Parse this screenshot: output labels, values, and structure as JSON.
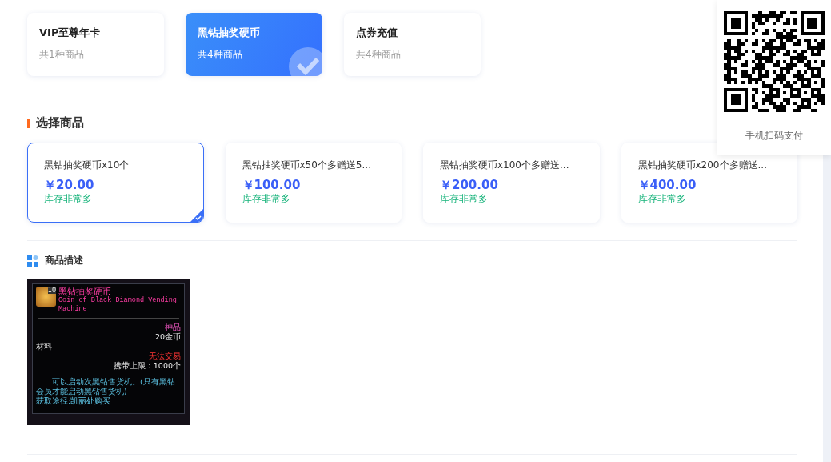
{
  "categories": [
    {
      "name": "VIP至尊年卡",
      "count": "共1种商品",
      "selected": false
    },
    {
      "name": "黑钻抽奖硬币",
      "count": "共4种商品",
      "selected": true
    },
    {
      "name": "点券充值",
      "count": "共4种商品",
      "selected": false
    }
  ],
  "products_section": {
    "title": "选择商品"
  },
  "products": [
    {
      "name": "黑钻抽奖硬币x10个",
      "price": "￥20.00",
      "stock": "库存非常多",
      "selected": true
    },
    {
      "name": "黑钻抽奖硬币x50个多赠送5...",
      "price": "￥100.00",
      "stock": "库存非常多",
      "selected": false
    },
    {
      "name": "黑钻抽奖硬币x100个多赠送...",
      "price": "￥200.00",
      "stock": "库存非常多",
      "selected": false
    },
    {
      "name": "黑钻抽奖硬币x200个多赠送...",
      "price": "￥400.00",
      "stock": "库存非常多",
      "selected": false
    }
  ],
  "description_section": {
    "title": "商品描述",
    "tooltip": {
      "badge": "10",
      "title": "黑钻抽奖硬币",
      "subtitle": "Coin of Black Diamond Vending Machine",
      "grade": "神品",
      "value": "20金币",
      "type": "材料",
      "trade": "无法交易",
      "limit": "携带上限：1000个",
      "description": "可以启动次黑钻售货机。(只有黑钻会员才能启动黑钻售货机)",
      "source": "获取途径:凯丽处购买"
    }
  },
  "qr_panel": {
    "caption": "手机扫码支付"
  }
}
